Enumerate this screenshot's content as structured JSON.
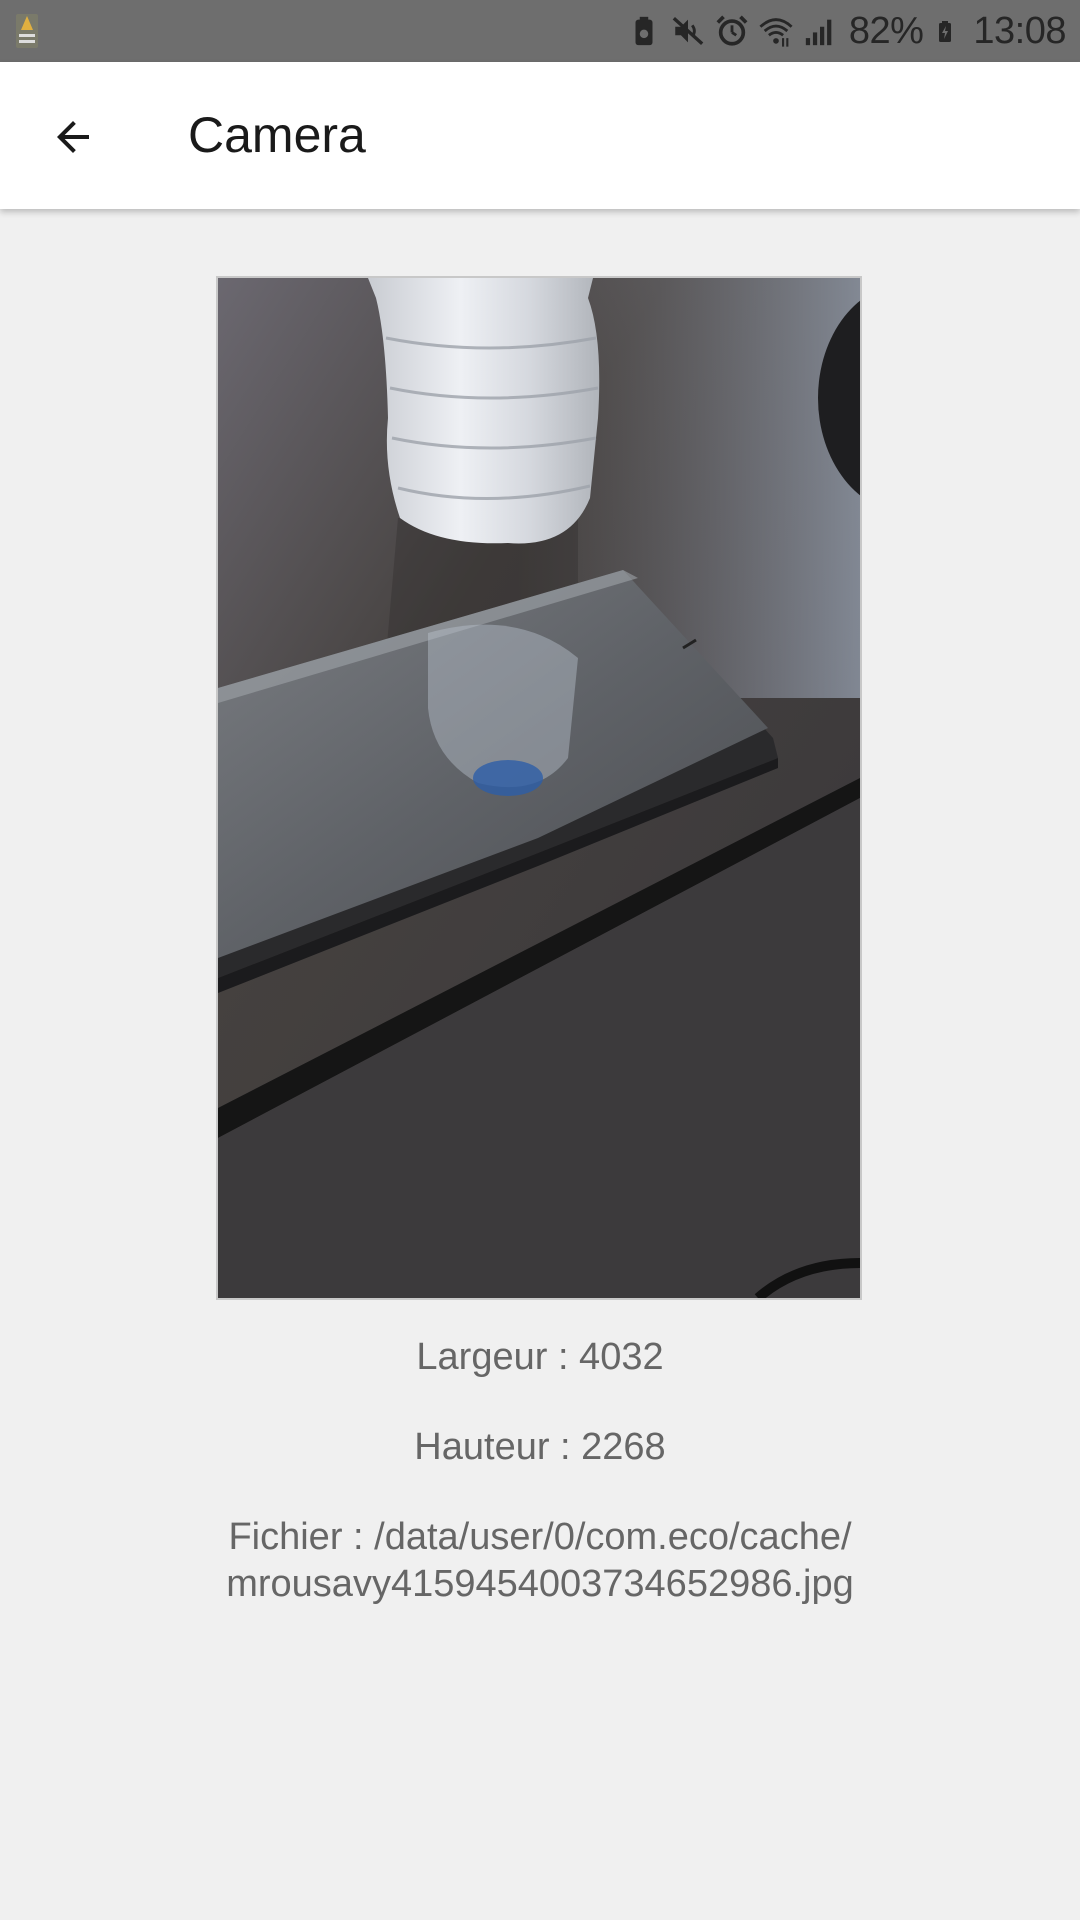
{
  "status_bar": {
    "battery_percent": "82%",
    "time": "13:08",
    "icons": [
      "recycle-icon",
      "mute-icon",
      "alarm-icon",
      "wifi-icon",
      "signal-icon",
      "battery-charging-icon"
    ],
    "background": "#6e6e6e"
  },
  "app_bar": {
    "title": "Camera",
    "back_icon": "arrow-back-icon"
  },
  "photo": {
    "description_icon": "captured-photo"
  },
  "info": {
    "width_text": "Largeur : 4032",
    "height_text": "Hauteur : 2268",
    "file_line1": "Fichier : /data/user/0/com.eco/cache/",
    "file_line2": "mrousavy4159454003734652986.jpg"
  },
  "colors": {
    "background": "#f0f0f0",
    "app_bar": "#ffffff",
    "text_secondary": "#666666"
  }
}
